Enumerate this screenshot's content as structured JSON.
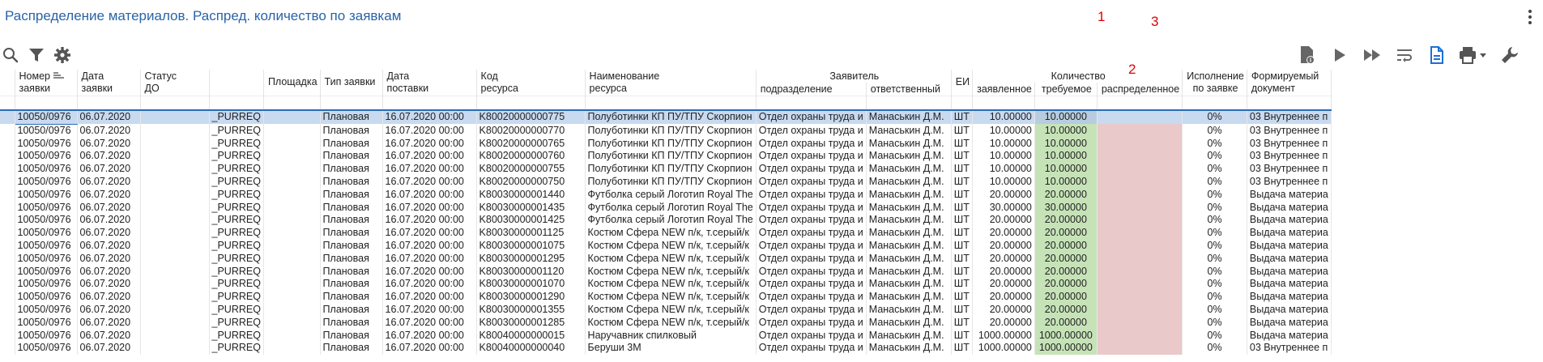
{
  "title": "Распределение материалов. Распред. количество по заявкам",
  "annotations": [
    "1",
    "2",
    "3"
  ],
  "toolbar_left": [
    "search-icon",
    "filter-icon",
    "settings-icon"
  ],
  "toolbar_right": [
    "document-info-icon",
    "play-icon",
    "fast-forward-icon",
    "wrap-icon",
    "document-icon",
    "print-icon",
    "wrench-icon"
  ],
  "columns": {
    "num": "Номер\nзаявки",
    "date": "Дата\nзаявки",
    "status": "Статус\nДО",
    "blank": "",
    "site": "Площадка",
    "type": "Тип заявки",
    "delivery": "Дата\nпоставки",
    "code": "Код\nресурса",
    "name": "Наименование\nресурса",
    "applicant": "Заявитель",
    "dept": "подразделение",
    "resp": "ответственный",
    "unit": "ЕИ",
    "qty": "Количество",
    "declared": "заявленное",
    "required": "требуемое",
    "distributed": "распределенное",
    "exec": "Исполнение\nпо заявке",
    "doc": "Формируемый\nдокумент"
  },
  "rows": [
    {
      "num": "10050/0976",
      "date": "06.07.2020",
      "status": "",
      "blank": "_PURREQ",
      "site": "",
      "type": "Плановая",
      "delivery": "16.07.2020 00:00",
      "code": "K80020000000775",
      "name": "Полуботинки КП ПУ/ТПУ Скорпион",
      "dept": "Отдел охраны труда  и",
      "resp": "Манаськин Д.М.",
      "unit": "ШТ",
      "declared": "10.00000",
      "required": "10.00000",
      "distributed": "",
      "exec": "0%",
      "doc": "03 Внутреннее п"
    },
    {
      "num": "10050/0976",
      "date": "06.07.2020",
      "status": "",
      "blank": "_PURREQ",
      "site": "",
      "type": "Плановая",
      "delivery": "16.07.2020 00:00",
      "code": "K80020000000770",
      "name": "Полуботинки КП ПУ/ТПУ Скорпион",
      "dept": "Отдел охраны труда  и",
      "resp": "Манаськин Д.М.",
      "unit": "ШТ",
      "declared": "10.00000",
      "required": "10.00000",
      "distributed": "",
      "exec": "0%",
      "doc": "03 Внутреннее п"
    },
    {
      "num": "10050/0976",
      "date": "06.07.2020",
      "status": "",
      "blank": "_PURREQ",
      "site": "",
      "type": "Плановая",
      "delivery": "16.07.2020 00:00",
      "code": "K80020000000765",
      "name": "Полуботинки КП ПУ/ТПУ Скорпион",
      "dept": "Отдел охраны труда  и",
      "resp": "Манаськин Д.М.",
      "unit": "ШТ",
      "declared": "10.00000",
      "required": "10.00000",
      "distributed": "",
      "exec": "0%",
      "doc": "03 Внутреннее п"
    },
    {
      "num": "10050/0976",
      "date": "06.07.2020",
      "status": "",
      "blank": "_PURREQ",
      "site": "",
      "type": "Плановая",
      "delivery": "16.07.2020 00:00",
      "code": "K80020000000760",
      "name": "Полуботинки КП ПУ/ТПУ Скорпион",
      "dept": "Отдел охраны труда  и",
      "resp": "Манаськин Д.М.",
      "unit": "ШТ",
      "declared": "10.00000",
      "required": "10.00000",
      "distributed": "",
      "exec": "0%",
      "doc": "03 Внутреннее п"
    },
    {
      "num": "10050/0976",
      "date": "06.07.2020",
      "status": "",
      "blank": "_PURREQ",
      "site": "",
      "type": "Плановая",
      "delivery": "16.07.2020 00:00",
      "code": "K80020000000755",
      "name": "Полуботинки КП ПУ/ТПУ Скорпион",
      "dept": "Отдел охраны труда  и",
      "resp": "Манаськин Д.М.",
      "unit": "ШТ",
      "declared": "10.00000",
      "required": "10.00000",
      "distributed": "",
      "exec": "0%",
      "doc": "03 Внутреннее п"
    },
    {
      "num": "10050/0976",
      "date": "06.07.2020",
      "status": "",
      "blank": "_PURREQ",
      "site": "",
      "type": "Плановая",
      "delivery": "16.07.2020 00:00",
      "code": "K80020000000750",
      "name": "Полуботинки КП ПУ/ТПУ Скорпион",
      "dept": "Отдел охраны труда  и",
      "resp": "Манаськин Д.М.",
      "unit": "ШТ",
      "declared": "10.00000",
      "required": "10.00000",
      "distributed": "",
      "exec": "0%",
      "doc": "03 Внутреннее п"
    },
    {
      "num": "10050/0976",
      "date": "06.07.2020",
      "status": "",
      "blank": "_PURREQ",
      "site": "",
      "type": "Плановая",
      "delivery": "16.07.2020 00:00",
      "code": "K80030000001440",
      "name": "Футболка серый Логотип Royal The",
      "dept": "Отдел охраны труда  и",
      "resp": "Манаськин Д.М.",
      "unit": "ШТ",
      "declared": "20.00000",
      "required": "20.00000",
      "distributed": "",
      "exec": "0%",
      "doc": "Выдача материа"
    },
    {
      "num": "10050/0976",
      "date": "06.07.2020",
      "status": "",
      "blank": "_PURREQ",
      "site": "",
      "type": "Плановая",
      "delivery": "16.07.2020 00:00",
      "code": "K80030000001435",
      "name": "Футболка серый Логотип Royal The",
      "dept": "Отдел охраны труда  и",
      "resp": "Манаськин Д.М.",
      "unit": "ШТ",
      "declared": "30.00000",
      "required": "30.00000",
      "distributed": "",
      "exec": "0%",
      "doc": "Выдача материа"
    },
    {
      "num": "10050/0976",
      "date": "06.07.2020",
      "status": "",
      "blank": "_PURREQ",
      "site": "",
      "type": "Плановая",
      "delivery": "16.07.2020 00:00",
      "code": "K80030000001425",
      "name": "Футболка серый Логотип Royal The",
      "dept": "Отдел охраны труда  и",
      "resp": "Манаськин Д.М.",
      "unit": "ШТ",
      "declared": "20.00000",
      "required": "20.00000",
      "distributed": "",
      "exec": "0%",
      "doc": "Выдача материа"
    },
    {
      "num": "10050/0976",
      "date": "06.07.2020",
      "status": "",
      "blank": "_PURREQ",
      "site": "",
      "type": "Плановая",
      "delivery": "16.07.2020 00:00",
      "code": "K80030000001125",
      "name": "Костюм Сфера NEW п/к, т.серый/к",
      "dept": "Отдел охраны труда  и",
      "resp": "Манаськин Д.М.",
      "unit": "ШТ",
      "declared": "20.00000",
      "required": "20.00000",
      "distributed": "",
      "exec": "0%",
      "doc": "Выдача материа"
    },
    {
      "num": "10050/0976",
      "date": "06.07.2020",
      "status": "",
      "blank": "_PURREQ",
      "site": "",
      "type": "Плановая",
      "delivery": "16.07.2020 00:00",
      "code": "K80030000001075",
      "name": "Костюм Сфера NEW п/к, т.серый/к",
      "dept": "Отдел охраны труда  и",
      "resp": "Манаськин Д.М.",
      "unit": "ШТ",
      "declared": "20.00000",
      "required": "20.00000",
      "distributed": "",
      "exec": "0%",
      "doc": "Выдача материа"
    },
    {
      "num": "10050/0976",
      "date": "06.07.2020",
      "status": "",
      "blank": "_PURREQ",
      "site": "",
      "type": "Плановая",
      "delivery": "16.07.2020 00:00",
      "code": "K80030000001295",
      "name": "Костюм Сфера NEW п/к, т.серый/к",
      "dept": "Отдел охраны труда  и",
      "resp": "Манаськин Д.М.",
      "unit": "ШТ",
      "declared": "20.00000",
      "required": "20.00000",
      "distributed": "",
      "exec": "0%",
      "doc": "Выдача материа"
    },
    {
      "num": "10050/0976",
      "date": "06.07.2020",
      "status": "",
      "blank": "_PURREQ",
      "site": "",
      "type": "Плановая",
      "delivery": "16.07.2020 00:00",
      "code": "K80030000001120",
      "name": "Костюм Сфера NEW п/к, т.серый/к",
      "dept": "Отдел охраны труда  и",
      "resp": "Манаськин Д.М.",
      "unit": "ШТ",
      "declared": "20.00000",
      "required": "20.00000",
      "distributed": "",
      "exec": "0%",
      "doc": "Выдача материа"
    },
    {
      "num": "10050/0976",
      "date": "06.07.2020",
      "status": "",
      "blank": "_PURREQ",
      "site": "",
      "type": "Плановая",
      "delivery": "16.07.2020 00:00",
      "code": "K80030000001070",
      "name": "Костюм Сфера NEW п/к, т.серый/к",
      "dept": "Отдел охраны труда  и",
      "resp": "Манаськин Д.М.",
      "unit": "ШТ",
      "declared": "20.00000",
      "required": "20.00000",
      "distributed": "",
      "exec": "0%",
      "doc": "Выдача материа"
    },
    {
      "num": "10050/0976",
      "date": "06.07.2020",
      "status": "",
      "blank": "_PURREQ",
      "site": "",
      "type": "Плановая",
      "delivery": "16.07.2020 00:00",
      "code": "K80030000001290",
      "name": "Костюм Сфера NEW п/к, т.серый/к",
      "dept": "Отдел охраны труда  и",
      "resp": "Манаськин Д.М.",
      "unit": "ШТ",
      "declared": "20.00000",
      "required": "20.00000",
      "distributed": "",
      "exec": "0%",
      "doc": "Выдача материа"
    },
    {
      "num": "10050/0976",
      "date": "06.07.2020",
      "status": "",
      "blank": "_PURREQ",
      "site": "",
      "type": "Плановая",
      "delivery": "16.07.2020 00:00",
      "code": "K80030000001355",
      "name": "Костюм Сфера NEW п/к, т.серый/к",
      "dept": "Отдел охраны труда  и",
      "resp": "Манаськин Д.М.",
      "unit": "ШТ",
      "declared": "20.00000",
      "required": "20.00000",
      "distributed": "",
      "exec": "0%",
      "doc": "Выдача материа"
    },
    {
      "num": "10050/0976",
      "date": "06.07.2020",
      "status": "",
      "blank": "_PURREQ",
      "site": "",
      "type": "Плановая",
      "delivery": "16.07.2020 00:00",
      "code": "K80030000001285",
      "name": "Костюм Сфера NEW п/к, т.серый/к",
      "dept": "Отдел охраны труда  и",
      "resp": "Манаськин Д.М.",
      "unit": "ШТ",
      "declared": "20.00000",
      "required": "20.00000",
      "distributed": "",
      "exec": "0%",
      "doc": "Выдача материа"
    },
    {
      "num": "10050/0976",
      "date": "06.07.2020",
      "status": "",
      "blank": "_PURREQ",
      "site": "",
      "type": "Плановая",
      "delivery": "16.07.2020 00:00",
      "code": "K80040000000015",
      "name": "Наручавник спилковый",
      "dept": "Отдел охраны труда  и",
      "resp": "Манаськин Д.М.",
      "unit": "ШТ",
      "declared": "1000.00000",
      "required": "1000.00000",
      "distributed": "",
      "exec": "0%",
      "doc": "Выдача материа"
    },
    {
      "num": "10050/0976",
      "date": "06.07.2020",
      "status": "",
      "blank": "_PURREQ",
      "site": "",
      "type": "Плановая",
      "delivery": "16.07.2020 00:00",
      "code": "K80040000000040",
      "name": "Беруши 3М",
      "dept": "Отдел охраны труда  и",
      "resp": "Манаськин Д.М.",
      "unit": "ШТ",
      "declared": "1000.00000",
      "required": "1000.00000",
      "distributed": "",
      "exec": "0%",
      "doc": "03 Внутреннее п"
    }
  ],
  "colors": {
    "accent": "#2a63a8",
    "required_bg": "#c6e3b8",
    "distributed_bg": "#eac9cb",
    "selected_row": "#c8daf0",
    "annotation": "#e00000"
  }
}
